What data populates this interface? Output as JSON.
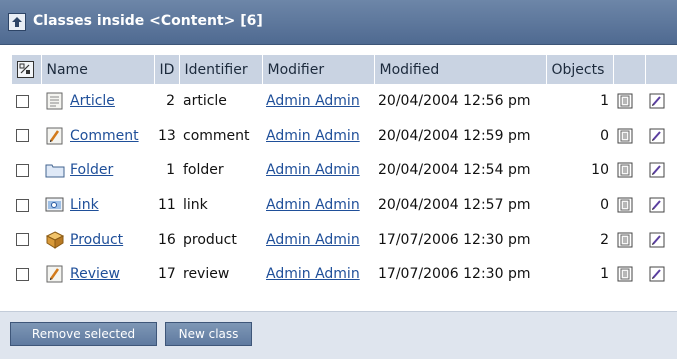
{
  "window": {
    "title": "Classes inside <Content> [6]"
  },
  "table": {
    "headers": {
      "name": "Name",
      "id": "ID",
      "identifier": "Identifier",
      "modifier": "Modifier",
      "modified": "Modified",
      "objects": "Objects"
    },
    "rows": [
      {
        "name": "Article",
        "id": "2",
        "identifier": "article",
        "modifier": "Admin Admin",
        "modified": "20/04/2004 12:56 pm",
        "objects": "1",
        "icon": "article-icon"
      },
      {
        "name": "Comment",
        "id": "13",
        "identifier": "comment",
        "modifier": "Admin Admin",
        "modified": "20/04/2004 12:59 pm",
        "objects": "0",
        "icon": "comment-icon"
      },
      {
        "name": "Folder",
        "id": "1",
        "identifier": "folder",
        "modifier": "Admin Admin",
        "modified": "20/04/2004 12:54 pm",
        "objects": "10",
        "icon": "folder-icon"
      },
      {
        "name": "Link",
        "id": "11",
        "identifier": "link",
        "modifier": "Admin Admin",
        "modified": "20/04/2004 12:57 pm",
        "objects": "0",
        "icon": "link-icon"
      },
      {
        "name": "Product",
        "id": "16",
        "identifier": "product",
        "modifier": "Admin Admin",
        "modified": "17/07/2006 12:30 pm",
        "objects": "2",
        "icon": "product-icon"
      },
      {
        "name": "Review",
        "id": "17",
        "identifier": "review",
        "modifier": "Admin Admin",
        "modified": "17/07/2006 12:30 pm",
        "objects": "1",
        "icon": "review-icon"
      }
    ]
  },
  "buttons": {
    "remove": "Remove selected",
    "new_class": "New class"
  },
  "colors": {
    "titlebar": "#5b7599",
    "header": "#c9d3e2",
    "link": "#1f4f99",
    "button": "#6d88ad"
  }
}
